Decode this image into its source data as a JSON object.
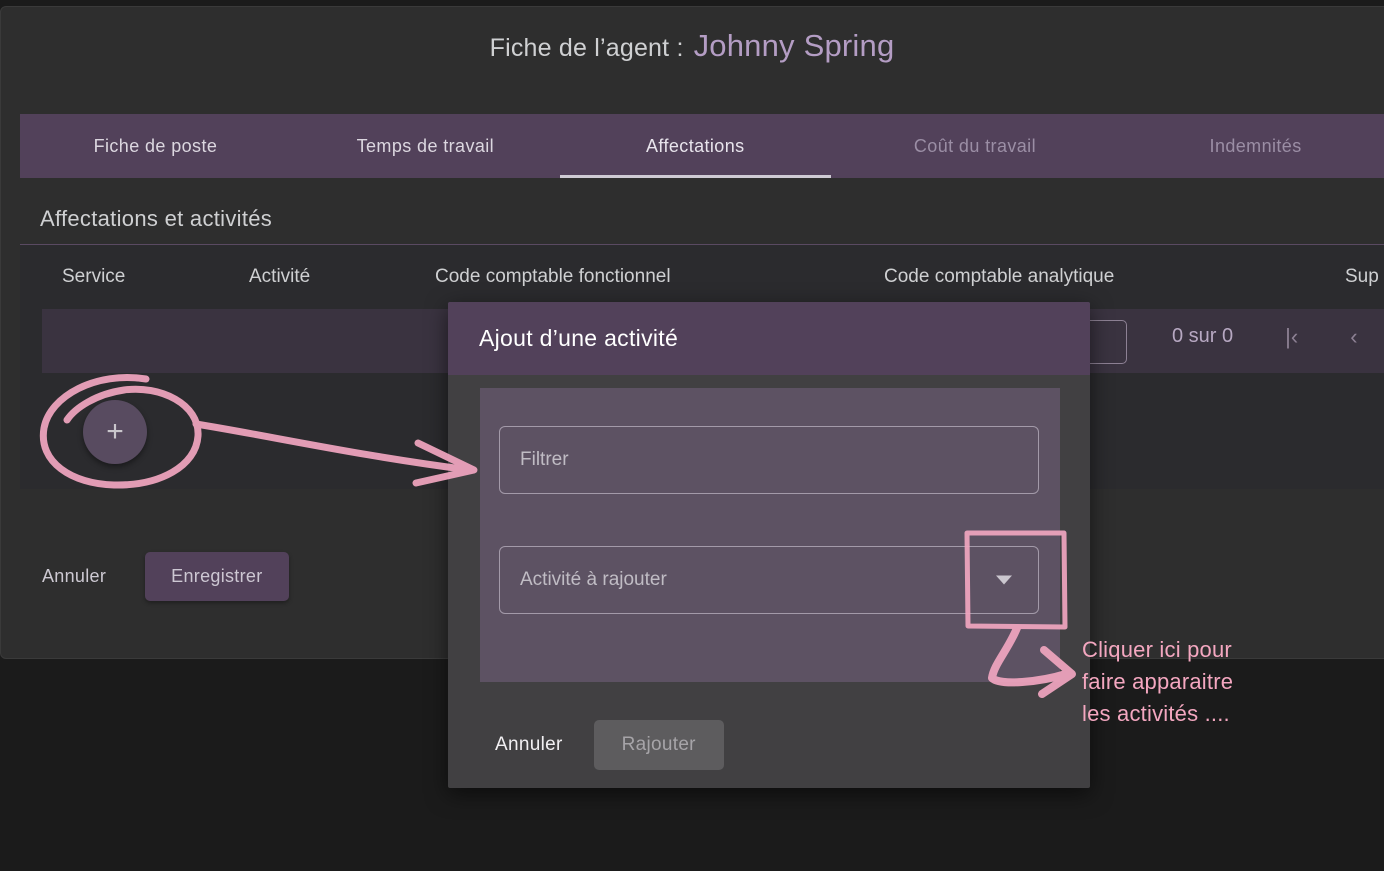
{
  "header": {
    "title_lead": "Fiche de l’agent :",
    "agent_name": "Johnny Spring"
  },
  "tabs": [
    {
      "label": "Fiche de poste",
      "state": "normal"
    },
    {
      "label": "Temps de travail",
      "state": "normal"
    },
    {
      "label": "Affectations",
      "state": "active"
    },
    {
      "label": "Coût du travail",
      "state": "muted"
    },
    {
      "label": "Indemnités",
      "state": "muted"
    }
  ],
  "section": {
    "title": "Affectations et activités"
  },
  "table": {
    "columns": [
      "Service",
      "Activité",
      "Code comptable fonctionnel",
      "Code comptable analytique",
      "Sup"
    ],
    "pagination": {
      "count_label": "0 sur 0",
      "first_icon": "first-page-icon",
      "prev_icon": "previous-page-icon",
      "first_glyph": "|‹",
      "prev_glyph": "‹"
    }
  },
  "fab": {
    "icon": "plus-icon",
    "glyph": "+"
  },
  "footer": {
    "cancel_label": "Annuler",
    "save_label": "Enregistrer"
  },
  "modal": {
    "title": "Ajout d’une activité",
    "filter_placeholder": "Filtrer",
    "filter_value": "",
    "select_placeholder": "Activité à rajouter",
    "select_value": "",
    "select_caret_icon": "chevron-down-icon",
    "cancel_label": "Annuler",
    "confirm_label": "Rajouter"
  },
  "annotations": {
    "note_text": "Cliquer ici pour\nfaire apparaitre\nles activités ....",
    "ink_color": "#f0a5bf",
    "circle_name": "ink-circle-around-add-button",
    "arrow_to_modal_name": "ink-arrow-to-modal",
    "highlight_box_name": "ink-box-around-dropdown",
    "arrow_to_note_name": "ink-arrow-to-note"
  },
  "colors": {
    "page_bg": "#1b1b1b",
    "card_bg": "#2e2e2e",
    "accent_purple": "#52415a",
    "panel_purple": "#5d5263",
    "agent_name": "#b49dc4",
    "ink_pink": "#f0a5bf"
  }
}
